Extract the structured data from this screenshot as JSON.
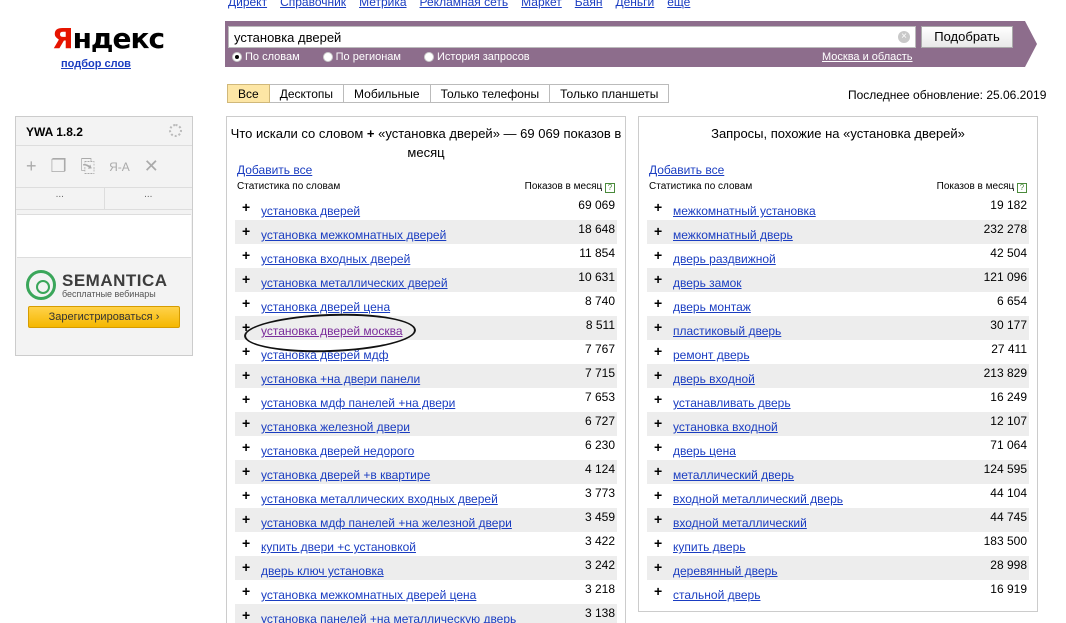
{
  "topnav": [
    "Директ",
    "Справочник",
    "Метрика",
    "Рекламная сеть",
    "Маркет",
    "Баян",
    "Деньги",
    "еще"
  ],
  "logo": {
    "text_y": "Я",
    "text_rest": "ндекс",
    "subtitle": "подбор слов"
  },
  "search": {
    "value": "установка дверей",
    "button": "Подобрать",
    "clear": "×",
    "modes": [
      "По словам",
      "По регионам",
      "История запросов"
    ],
    "region": "Москва и область"
  },
  "tabs": [
    "Все",
    "Десктопы",
    "Мобильные",
    "Только телефоны",
    "Только планшеты"
  ],
  "last_update": "Последнее обновление: 25.06.2019",
  "ywa": {
    "title": "YWA 1.8.2",
    "dots1": "...",
    "dots2": "...",
    "semantica_name": "SEMANTICA",
    "semantica_sub": "бесплатные вебинары",
    "register": "Зарегистрироваться ›"
  },
  "left": {
    "title_pre": "Что искали со словом",
    "title_plus": "+",
    "title_post": "«установка дверей» — 69 069 показов в месяц",
    "add_all": "Добавить все",
    "col1": "Статистика по словам",
    "col2": "Показов в месяц",
    "rows": [
      {
        "kw": "установка дверей",
        "n": "69 069"
      },
      {
        "kw": "установка межкомнатных дверей",
        "n": "18 648"
      },
      {
        "kw": "установка входных дверей",
        "n": "11 854"
      },
      {
        "kw": "установка металлических дверей",
        "n": "10 631"
      },
      {
        "kw": "установка дверей цена",
        "n": "8 740"
      },
      {
        "kw": "установка дверей москва",
        "n": "8 511"
      },
      {
        "kw": "установка дверей мдф",
        "n": "7 767"
      },
      {
        "kw": "установка +на двери панели",
        "n": "7 715"
      },
      {
        "kw": "установка мдф панелей +на двери",
        "n": "7 653"
      },
      {
        "kw": "установка железной двери",
        "n": "6 727"
      },
      {
        "kw": "установка дверей недорого",
        "n": "6 230"
      },
      {
        "kw": "установка дверей +в квартире",
        "n": "4 124"
      },
      {
        "kw": "установка металлических входных дверей",
        "n": "3 773"
      },
      {
        "kw": "установка мдф панелей +на железной двери",
        "n": "3 459"
      },
      {
        "kw": "купить двери +с установкой",
        "n": "3 422"
      },
      {
        "kw": "дверь ключ установка",
        "n": "3 242"
      },
      {
        "kw": "установка межкомнатных дверей цена",
        "n": "3 218"
      },
      {
        "kw": "установка панелей +на металлическую дверь",
        "n": "3 138"
      }
    ]
  },
  "right": {
    "title": "Запросы, похожие на «установка дверей»",
    "add_all": "Добавить все",
    "col1": "Статистика по словам",
    "col2": "Показов в месяц",
    "rows": [
      {
        "kw": "межкомнатный установка",
        "n": "19 182"
      },
      {
        "kw": "межкомнатный дверь",
        "n": "232 278"
      },
      {
        "kw": "дверь раздвижной",
        "n": "42 504"
      },
      {
        "kw": "дверь замок",
        "n": "121 096"
      },
      {
        "kw": "дверь монтаж",
        "n": "6 654"
      },
      {
        "kw": "пластиковый дверь",
        "n": "30 177"
      },
      {
        "kw": "ремонт дверь",
        "n": "27 411"
      },
      {
        "kw": "дверь входной",
        "n": "213 829"
      },
      {
        "kw": "устанавливать дверь",
        "n": "16 249"
      },
      {
        "kw": "установка входной",
        "n": "12 107"
      },
      {
        "kw": "дверь цена",
        "n": "71 064"
      },
      {
        "kw": "металлический дверь",
        "n": "124 595"
      },
      {
        "kw": "входной металлический дверь",
        "n": "44 104"
      },
      {
        "kw": "входной металлический",
        "n": "44 745"
      },
      {
        "kw": "купить дверь",
        "n": "183 500"
      },
      {
        "kw": "деревянный дверь",
        "n": "28 998"
      },
      {
        "kw": "стальной дверь",
        "n": "16 919"
      }
    ]
  }
}
